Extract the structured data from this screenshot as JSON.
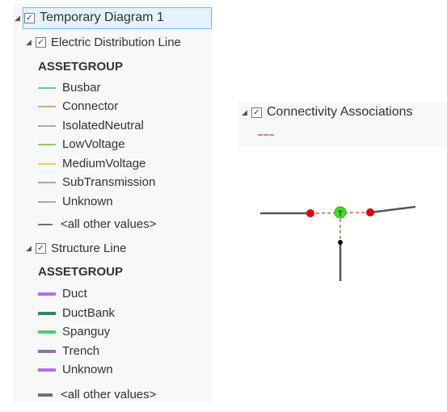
{
  "root": {
    "title": "Temporary Diagram 1",
    "checked": true
  },
  "layers": [
    {
      "title": "Electric Distribution Line",
      "checked": true,
      "field": "ASSETGROUP",
      "items": [
        {
          "label": "Busbar",
          "color": "#6ec8a8"
        },
        {
          "label": "Connector",
          "color": "#e8a070"
        },
        {
          "label": "IsolatedNeutral",
          "color": "#a0a8d0"
        },
        {
          "label": "LowVoltage",
          "color": "#90c870"
        },
        {
          "label": "MediumVoltage",
          "color": "#f0c870"
        },
        {
          "label": "SubTransmission",
          "color": "#c8a078"
        },
        {
          "label": "Unknown",
          "color": "#a8a8a8"
        }
      ],
      "other": {
        "label": "<all other values>",
        "color": "#707070"
      }
    },
    {
      "title": "Structure Line",
      "checked": true,
      "field": "ASSETGROUP",
      "items": [
        {
          "label": "Duct",
          "color": "#b070e0"
        },
        {
          "label": "DuctBank",
          "color": "#2e8b57"
        },
        {
          "label": "Spanguy",
          "color": "#50c878"
        },
        {
          "label": "Trench",
          "color": "#9070b0"
        },
        {
          "label": "Unknown",
          "color": "#b070e0"
        }
      ],
      "other": {
        "label": "<all other values>",
        "color": "#707070"
      }
    }
  ],
  "connectivity": {
    "title": "Connectivity Associations",
    "checked": true,
    "color": "#d9896a"
  },
  "diagram": {
    "junction_label": "T",
    "junction_color": "#44dd22",
    "endpoint_color": "#dd0000"
  }
}
